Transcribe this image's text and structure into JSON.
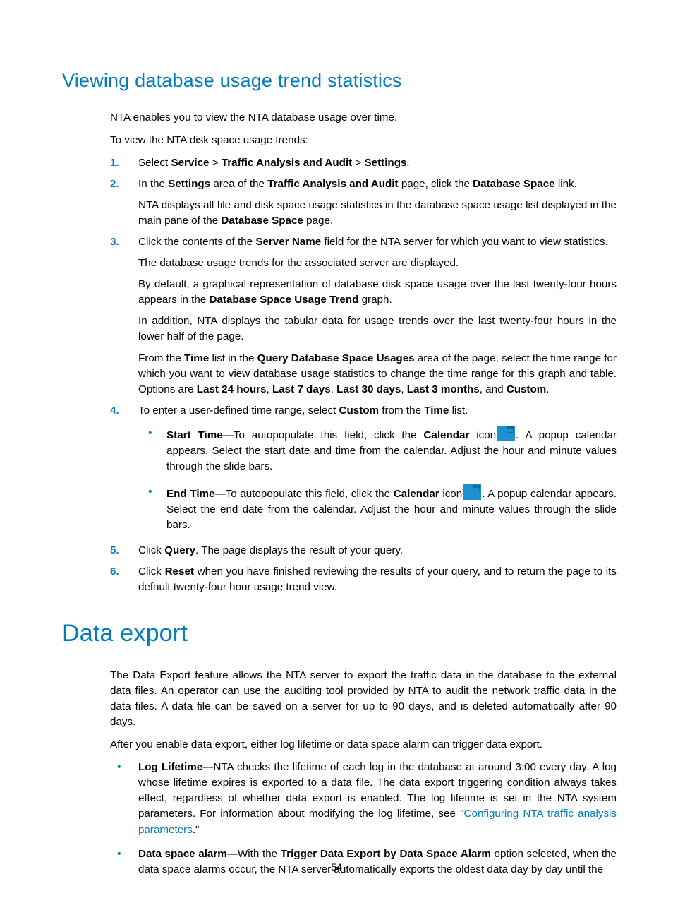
{
  "section1": {
    "heading": "Viewing database usage trend statistics",
    "intro1": "NTA enables you to view the NTA database usage over time.",
    "intro2": "To view the NTA disk space usage trends:",
    "steps": {
      "s1": {
        "num": "1.",
        "pre": "Select ",
        "b1": "Service",
        "gt1": " > ",
        "b2": "Traffic Analysis and Audit",
        "gt2": " > ",
        "b3": "Settings",
        "post": "."
      },
      "s2": {
        "num": "2.",
        "pre": "In the ",
        "b1": "Settings",
        "mid1": " area of the ",
        "b2": "Traffic Analysis and Audit",
        "mid2": " page, click the ",
        "b3": "Database Space",
        "post": " link.",
        "p2a": "NTA displays all file and disk space usage statistics in the database space usage list displayed in the main pane of the ",
        "p2b": "Database Space",
        "p2c": " page."
      },
      "s3": {
        "num": "3.",
        "p1a": "Click the contents of the ",
        "p1b": "Server Name",
        "p1c": " field for the NTA server for which you want to view statistics.",
        "p2": "The database usage trends for the associated server are displayed.",
        "p3a": "By default, a graphical representation of database disk space usage over the last twenty-four hours appears in the ",
        "p3b": "Database Space Usage Trend",
        "p3c": " graph.",
        "p4": "In addition, NTA displays the tabular data for usage trends over the last twenty-four hours in the lower half of the page.",
        "p5a": "From the ",
        "p5b": "Time",
        "p5c": " list in the ",
        "p5d": "Query Database Space Usages",
        "p5e": " area of the page, select the time range for which you want to view database usage statistics to change the time range for this graph and table. Options are ",
        "p5f": "Last 24 hours",
        "p5g": ", ",
        "p5h": "Last 7 days",
        "p5i": ", ",
        "p5j": "Last 30 days",
        "p5k": ", ",
        "p5l": "Last 3 months",
        "p5m": ", and ",
        "p5n": "Custom",
        "p5o": "."
      },
      "s4": {
        "num": "4.",
        "p1a": "To enter a user-defined time range, select ",
        "p1b": "Custom",
        "p1c": " from the ",
        "p1d": "Time",
        "p1e": " list.",
        "start": {
          "b": "Start Time",
          "t1": "—To autopopulate this field, click the ",
          "b2": "Calendar",
          "t2": " icon",
          "t3": ". A popup calendar appears. Select the start date and time from the calendar. Adjust the hour and minute values through the slide bars."
        },
        "end": {
          "b": "End Time",
          "t1": "—To autopopulate this field, click the ",
          "b2": "Calendar",
          "t2": " icon",
          "t3": ". A popup calendar appears. Select the end date from the calendar. Adjust the hour and minute values through the slide bars."
        }
      },
      "s5": {
        "num": "5.",
        "a": "Click ",
        "b": "Query",
        "c": ". The page displays the result of your query."
      },
      "s6": {
        "num": "6.",
        "a": "Click ",
        "b": "Reset",
        "c": " when you have finished reviewing the results of your query, and to return the page to its default twenty-four hour usage trend view."
      }
    }
  },
  "section2": {
    "heading": "Data export",
    "p1": "The Data Export feature allows the NTA server to export the traffic data in the database to the external data files. An operator can use the auditing tool provided by NTA to audit the network traffic data in the data files. A data file can be saved on a server for up to 90 days, and is deleted automatically after 90 days.",
    "p2": "After you enable data export, either log lifetime or data space alarm can trigger data export.",
    "b1": {
      "label": "Log Lifetime",
      "t1": "—NTA checks the lifetime of each log in the database at around 3:00 every day. A log whose lifetime expires is exported to a data file. The data export triggering condition always takes effect, regardless of whether data export is enabled. The log lifetime is set in the NTA system parameters. For information about modifying the log lifetime, see \"",
      "link": "Configuring NTA traffic analysis parameters",
      "t2": ".\""
    },
    "b2": {
      "label": "Data space alarm",
      "t1": "—With the ",
      "b": "Trigger Data Export by Data Space Alarm",
      "t2": " option selected, when the data space alarms occur, the NTA server automatically exports the oldest data day by day until the"
    }
  },
  "pagenum": "54"
}
